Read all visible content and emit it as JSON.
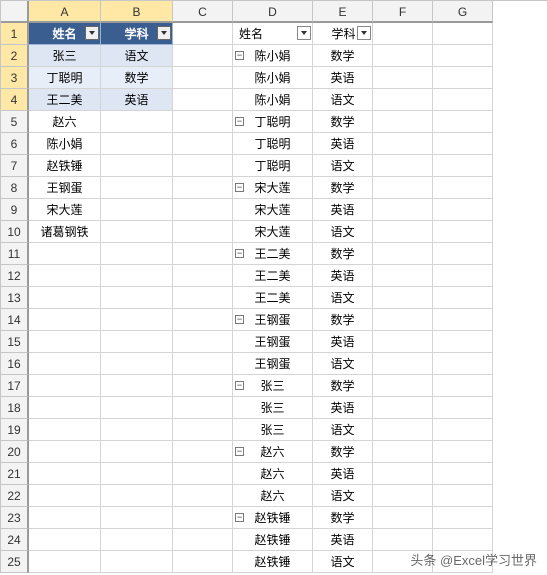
{
  "columns": [
    "A",
    "B",
    "C",
    "D",
    "E",
    "F",
    "G"
  ],
  "rows_count": 25,
  "headerAB": {
    "name": "姓名",
    "subject": "学科"
  },
  "tableAB": [
    {
      "name": "张三",
      "subject": "语文"
    },
    {
      "name": "丁聪明",
      "subject": "数学"
    },
    {
      "name": "王二美",
      "subject": "英语"
    },
    {
      "name": "赵六",
      "subject": ""
    },
    {
      "name": "陈小娟",
      "subject": ""
    },
    {
      "name": "赵铁锤",
      "subject": ""
    },
    {
      "name": "王钢蛋",
      "subject": ""
    },
    {
      "name": "宋大莲",
      "subject": ""
    },
    {
      "name": "诸葛钢铁",
      "subject": ""
    }
  ],
  "headerDE": {
    "name": "姓名",
    "subject": "学科"
  },
  "pivot": [
    {
      "name": "陈小娟",
      "subject": "数学",
      "group": true
    },
    {
      "name": "陈小娟",
      "subject": "英语"
    },
    {
      "name": "陈小娟",
      "subject": "语文"
    },
    {
      "name": "丁聪明",
      "subject": "数学",
      "group": true
    },
    {
      "name": "丁聪明",
      "subject": "英语"
    },
    {
      "name": "丁聪明",
      "subject": "语文"
    },
    {
      "name": "宋大莲",
      "subject": "数学",
      "group": true
    },
    {
      "name": "宋大莲",
      "subject": "英语"
    },
    {
      "name": "宋大莲",
      "subject": "语文"
    },
    {
      "name": "王二美",
      "subject": "数学",
      "group": true
    },
    {
      "name": "王二美",
      "subject": "英语"
    },
    {
      "name": "王二美",
      "subject": "语文"
    },
    {
      "name": "王钢蛋",
      "subject": "数学",
      "group": true
    },
    {
      "name": "王钢蛋",
      "subject": "英语"
    },
    {
      "name": "王钢蛋",
      "subject": "语文"
    },
    {
      "name": "张三",
      "subject": "数学",
      "group": true
    },
    {
      "name": "张三",
      "subject": "英语"
    },
    {
      "name": "张三",
      "subject": "语文"
    },
    {
      "name": "赵六",
      "subject": "数学",
      "group": true
    },
    {
      "name": "赵六",
      "subject": "英语"
    },
    {
      "name": "赵六",
      "subject": "语文"
    },
    {
      "name": "赵铁锤",
      "subject": "数学",
      "group": true
    },
    {
      "name": "赵铁锤",
      "subject": "英语"
    },
    {
      "name": "赵铁锤",
      "subject": "语文"
    }
  ],
  "selection": {
    "rows_highlight": [
      1,
      2,
      3,
      4
    ],
    "cols_highlight": [
      "A",
      "B"
    ],
    "striped_body_rows": [
      2,
      4
    ]
  },
  "watermark": "头条 @Excel学习世界"
}
